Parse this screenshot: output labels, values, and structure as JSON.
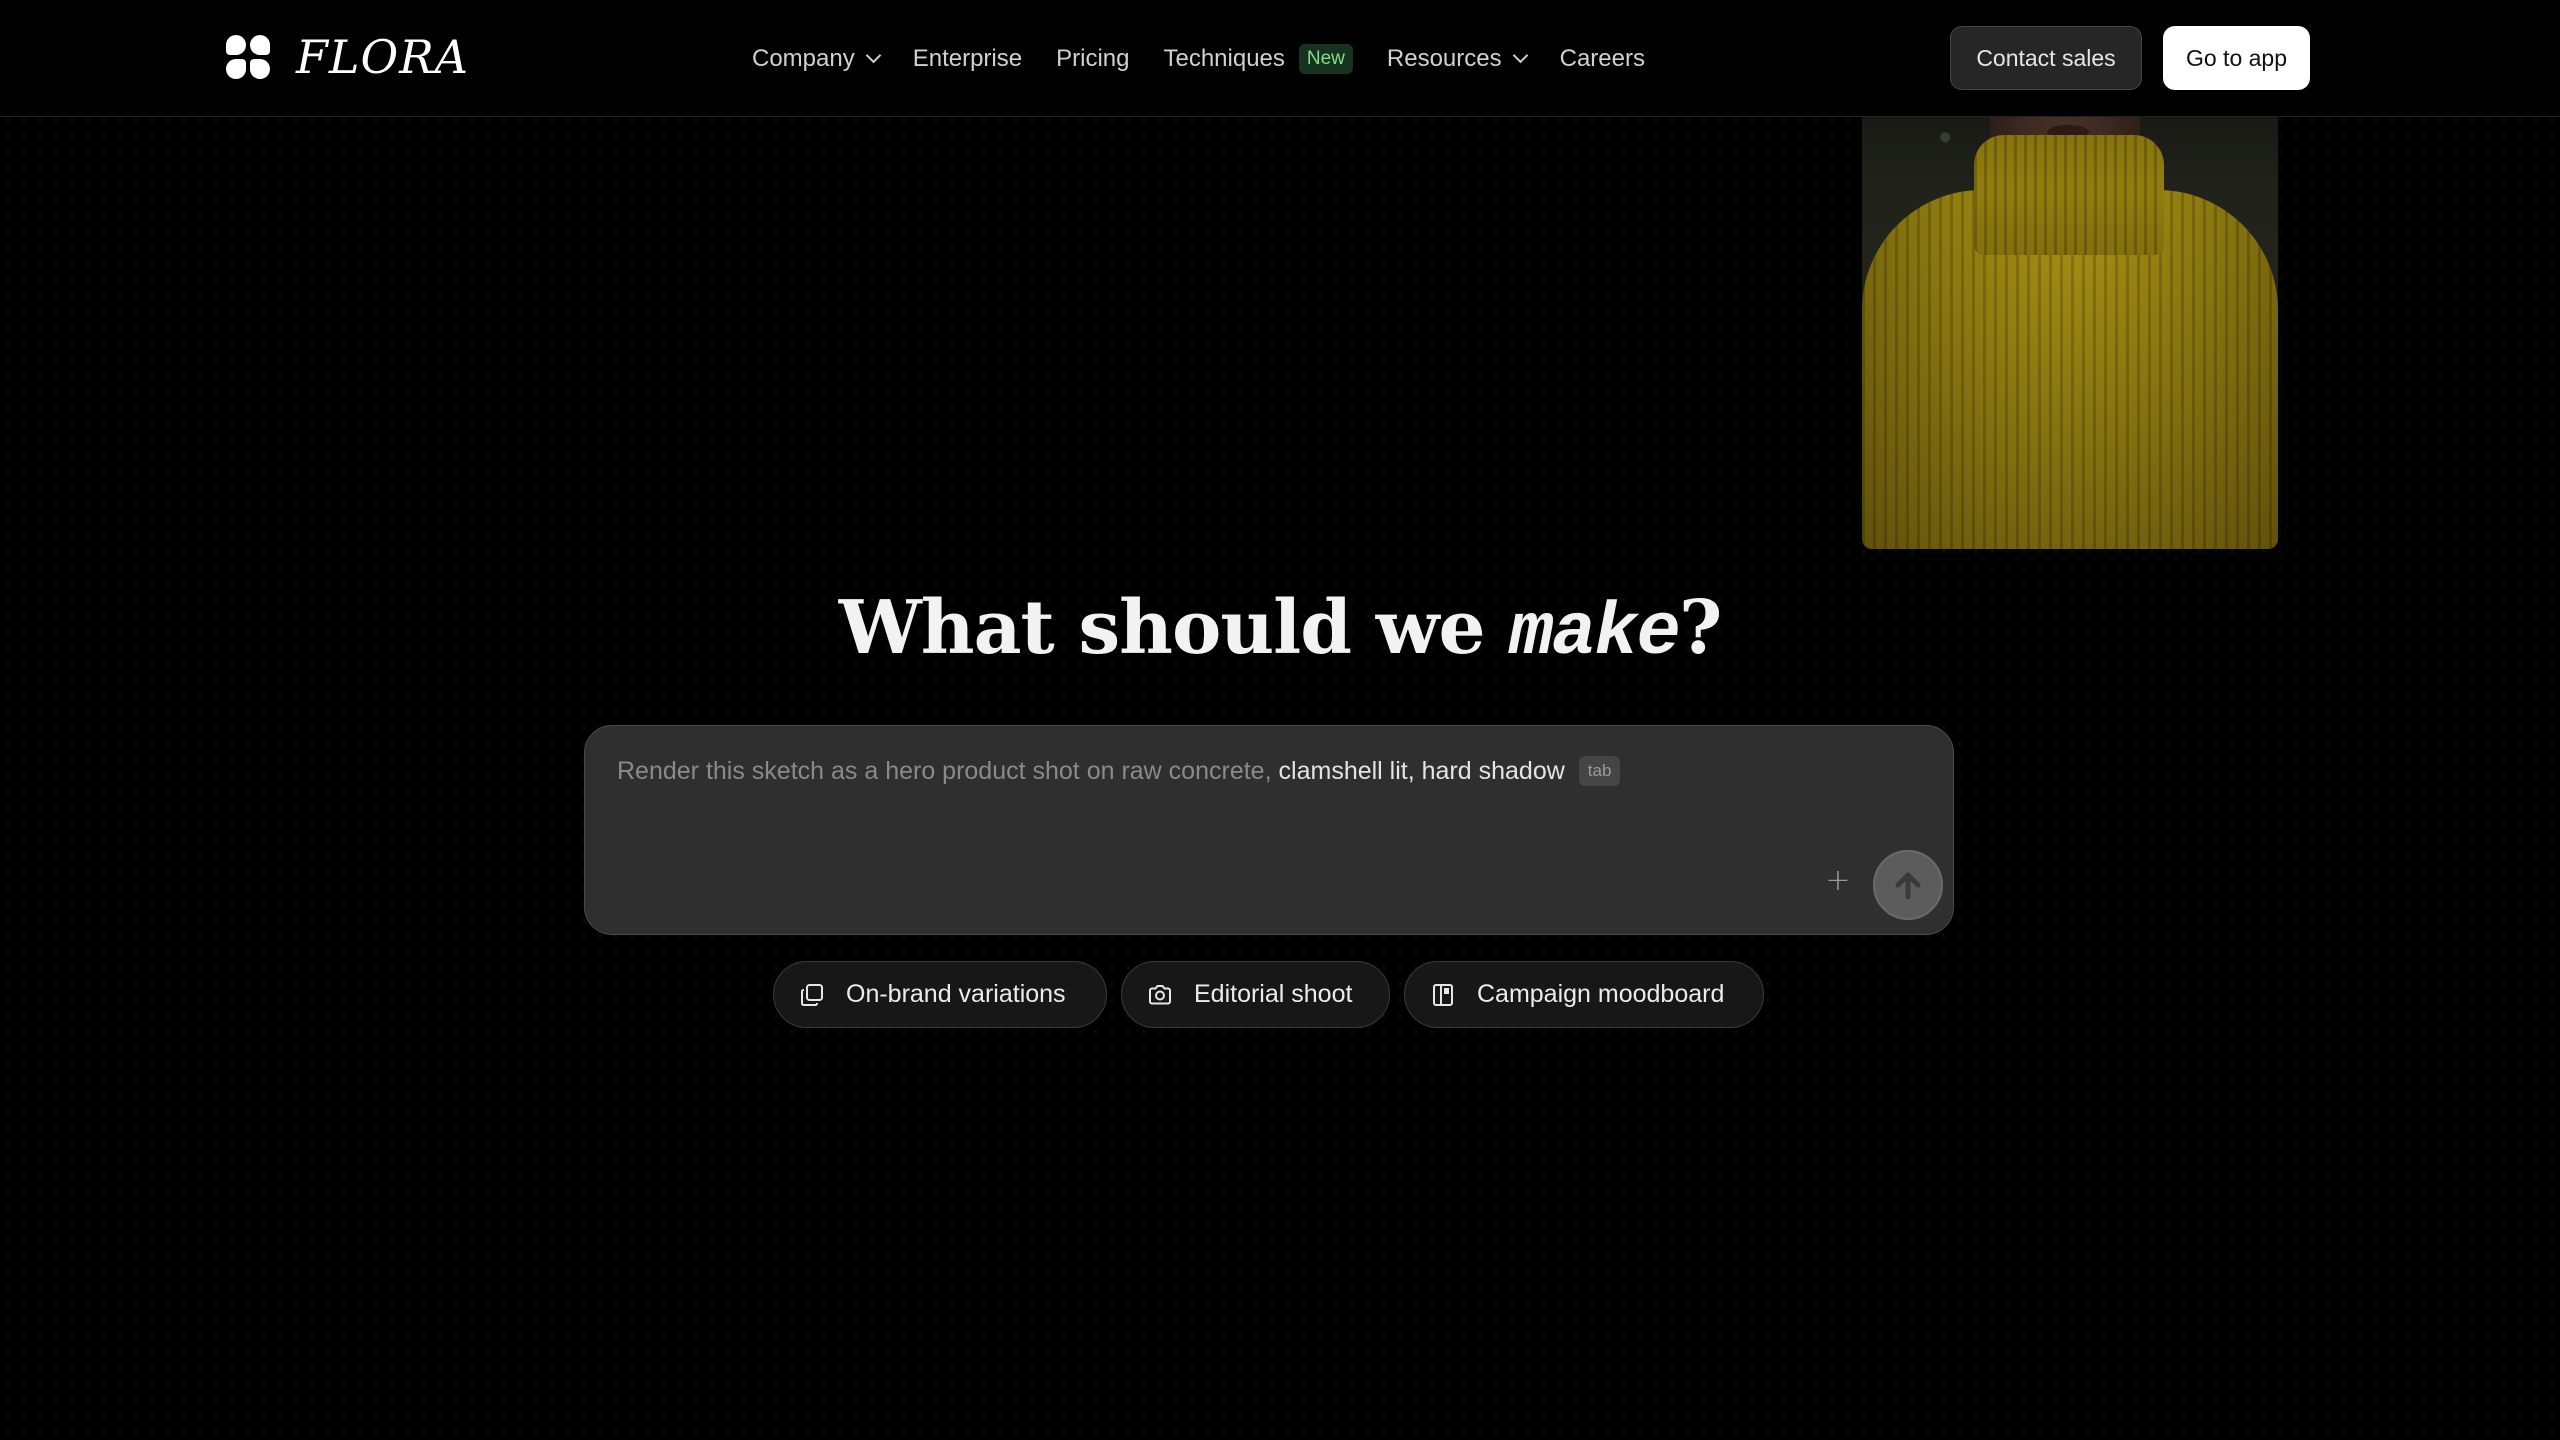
{
  "brand": {
    "name": "FLORA",
    "logo_icon": "flora-four-petal-icon"
  },
  "nav": {
    "items": [
      {
        "label": "Company",
        "has_dropdown": true
      },
      {
        "label": "Enterprise",
        "has_dropdown": false
      },
      {
        "label": "Pricing",
        "has_dropdown": false
      },
      {
        "label": "Techniques",
        "has_dropdown": false,
        "badge": "New"
      },
      {
        "label": "Resources",
        "has_dropdown": true
      },
      {
        "label": "Careers",
        "has_dropdown": false
      }
    ],
    "contact_label": "Contact sales",
    "app_label": "Go to app"
  },
  "hero": {
    "headline_prefix": "What should we ",
    "headline_emphasis": "make",
    "headline_suffix": "?"
  },
  "prompt": {
    "placeholder_part": "Render this sketch as a hero product shot on raw concrete,",
    "typed_part": "clamshell lit, hard shadow",
    "hint": "tab",
    "plus_icon": "plus-icon",
    "send_icon": "arrow-up-icon"
  },
  "suggestions": [
    {
      "label": "On-brand variations",
      "icon": "copy-stack-icon"
    },
    {
      "label": "Editorial shoot",
      "icon": "camera-icon"
    },
    {
      "label": "Campaign moodboard",
      "icon": "layout-grid-icon"
    }
  ],
  "colors": {
    "background": "#000000",
    "badge_bg": "#17321f",
    "badge_text": "#7ee08e",
    "prompt_bg": "#2f2f2f",
    "primary_button": "#ffffff"
  }
}
